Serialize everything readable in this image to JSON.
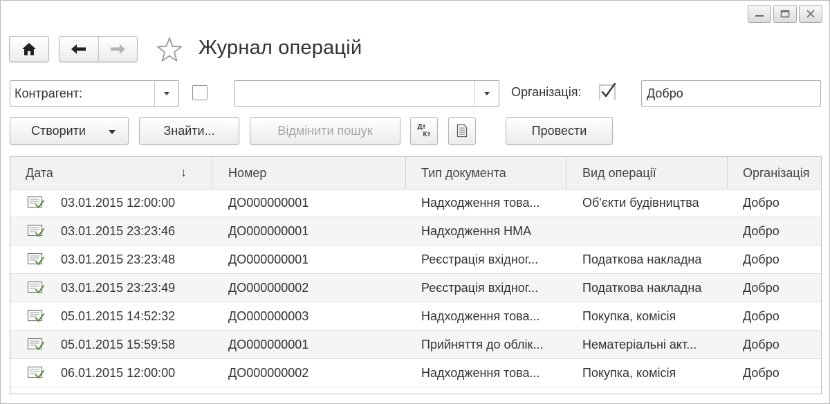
{
  "window": {
    "controls": {
      "minimize_icon": "minimize-icon",
      "maximize_icon": "maximize-icon",
      "close_icon": "close-icon"
    }
  },
  "header": {
    "title": "Журнал операцій",
    "icons": {
      "home": "home-icon",
      "back": "arrow-left-icon",
      "forward": "arrow-right-icon",
      "favorite": "star-icon"
    }
  },
  "filters": {
    "contractor": {
      "value": "Контрагент:"
    },
    "contractor_checked": false,
    "second_combo": {
      "value": ""
    },
    "organization_label": "Організація:",
    "organization_checked": true,
    "organization_value": "Добро"
  },
  "toolbar": {
    "create_label": "Створити",
    "find_label": "Знайти...",
    "cancel_search_label": "Відмінити пошук",
    "dtkt_top": "Дт",
    "dtkt_bottom": "Кт",
    "post_label": "Провести"
  },
  "table": {
    "columns": [
      "Дата",
      "Номер",
      "Тип документа",
      "Вид операції",
      "Організація"
    ],
    "sort_indicator": "↓",
    "rows": [
      {
        "date": "03.01.2015 12:00:00",
        "number": "ДО000000001",
        "doc_type": "Надходження това...",
        "operation": "Об'єкти будівництва",
        "org": "Добро"
      },
      {
        "date": "03.01.2015 23:23:46",
        "number": "ДО000000001",
        "doc_type": "Надходження НМА",
        "operation": "",
        "org": "Добро"
      },
      {
        "date": "03.01.2015 23:23:48",
        "number": "ДО000000001",
        "doc_type": "Реєстрація вхідног...",
        "operation": "Податкова накладна",
        "org": "Добро"
      },
      {
        "date": "03.01.2015 23:23:49",
        "number": "ДО000000002",
        "doc_type": "Реєстрація вхідног...",
        "operation": "Податкова накладна",
        "org": "Добро"
      },
      {
        "date": "05.01.2015 14:52:32",
        "number": "ДО000000003",
        "doc_type": "Надходження това...",
        "operation": "Покупка, комісія",
        "org": "Добро"
      },
      {
        "date": "05.01.2015 15:59:58",
        "number": "ДО000000001",
        "doc_type": "Прийняття до облік...",
        "operation": "Нематеріальні акт...",
        "org": "Добро"
      },
      {
        "date": "06.01.2015 12:00:00",
        "number": "ДО000000002",
        "doc_type": "Надходження това...",
        "operation": "Покупка, комісія",
        "org": "Добро"
      }
    ]
  }
}
